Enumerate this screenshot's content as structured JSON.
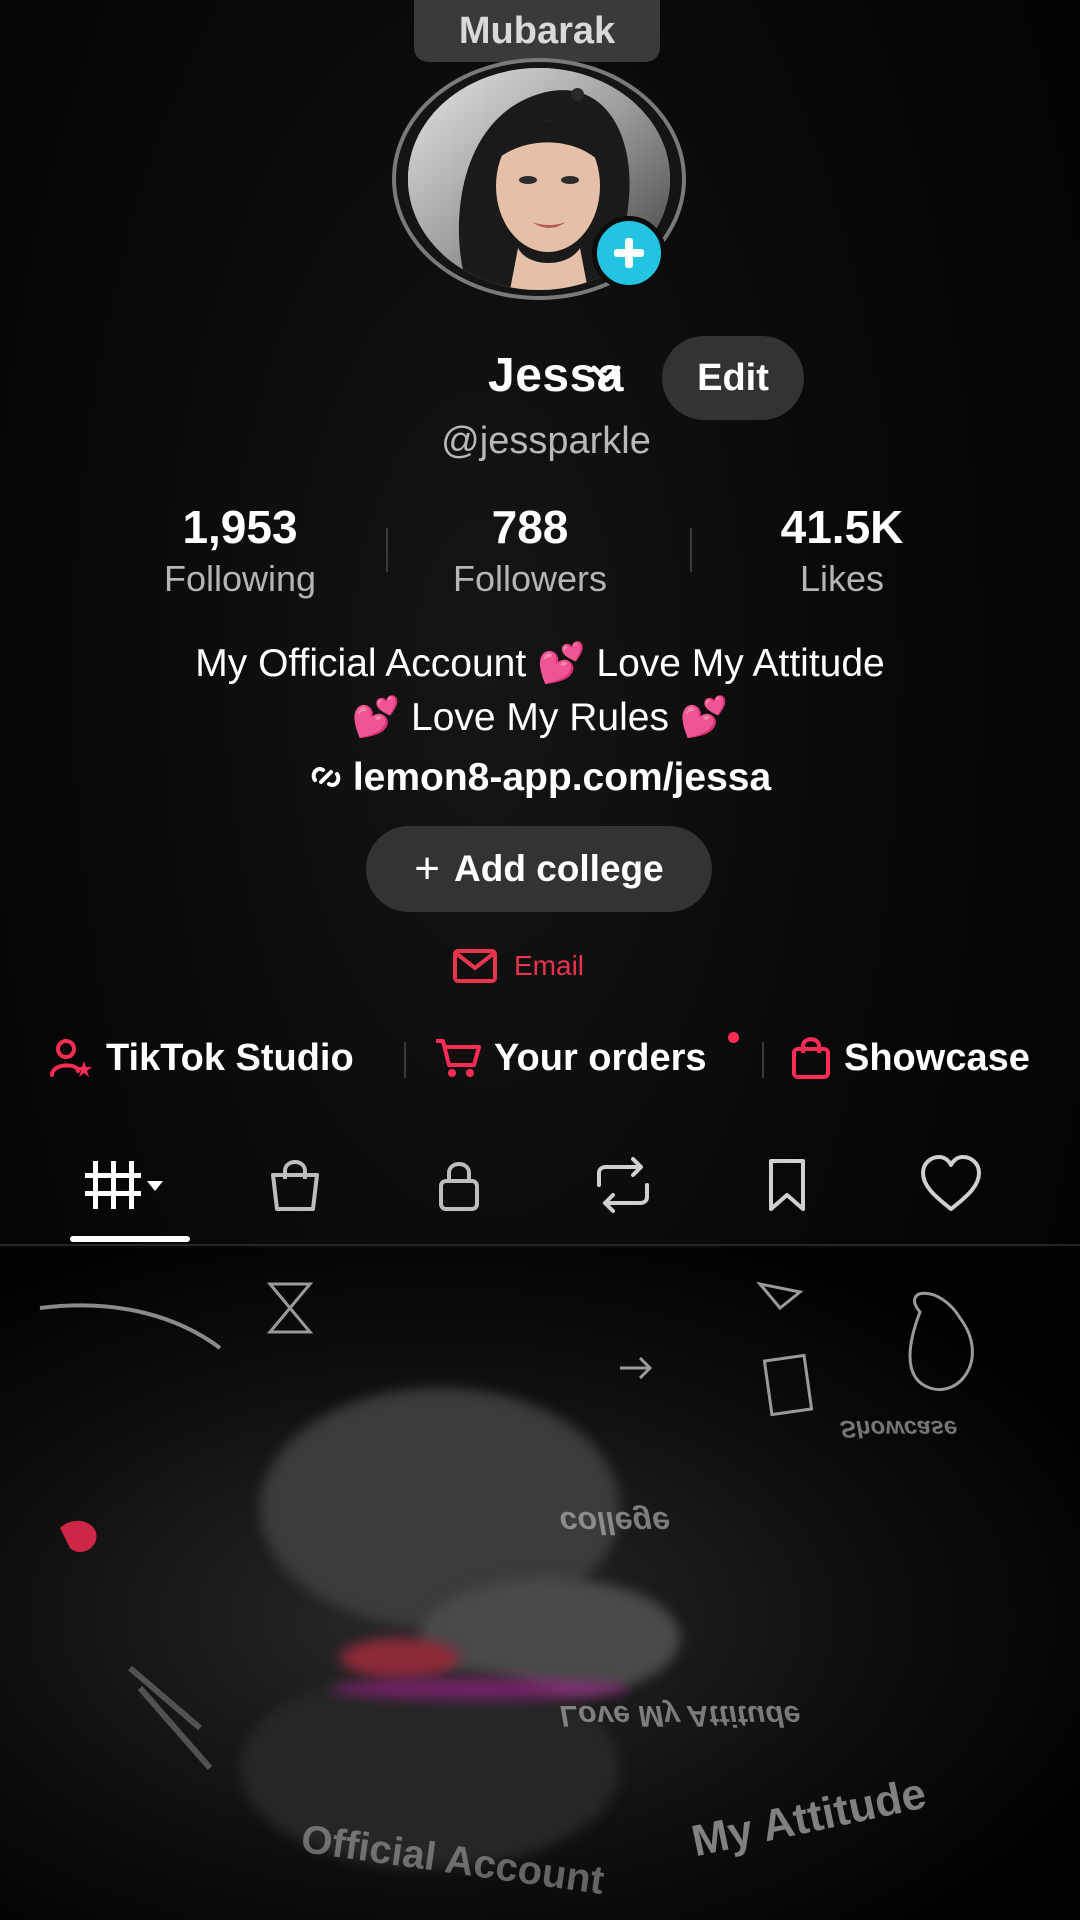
{
  "top_pill": {
    "label": "Mubarak"
  },
  "profile": {
    "name": "Jessa",
    "edit_label": "Edit",
    "handle": "@jessparkle"
  },
  "stats": [
    {
      "value": "1,953",
      "label": "Following"
    },
    {
      "value": "788",
      "label": "Followers"
    },
    {
      "value": "41.5K",
      "label": "Likes"
    }
  ],
  "bio": {
    "line1": "My Official Account 💕 Love My Attitude",
    "line2": "💕 Love My Rules 💕",
    "link": "lemon8-app.com/jessa"
  },
  "add_college_label": "Add college",
  "email_label": "Email",
  "shortcuts": {
    "studio": "TikTok Studio",
    "orders": "Your orders",
    "showcase": "Showcase"
  },
  "tabs": [
    "Videos",
    "Shop",
    "Private",
    "Reposts",
    "Favorites",
    "Liked"
  ],
  "colors": {
    "accent_red": "#fe2c55",
    "avatar_add": "#22c4e2",
    "pill_bg": "#333333"
  },
  "glitch_fragments": {
    "mirror1": "My Attitude",
    "mirror2": "Love My Attitude",
    "mirror3": "college",
    "mirror4": "Showcase",
    "mirror5": "Official Account"
  }
}
